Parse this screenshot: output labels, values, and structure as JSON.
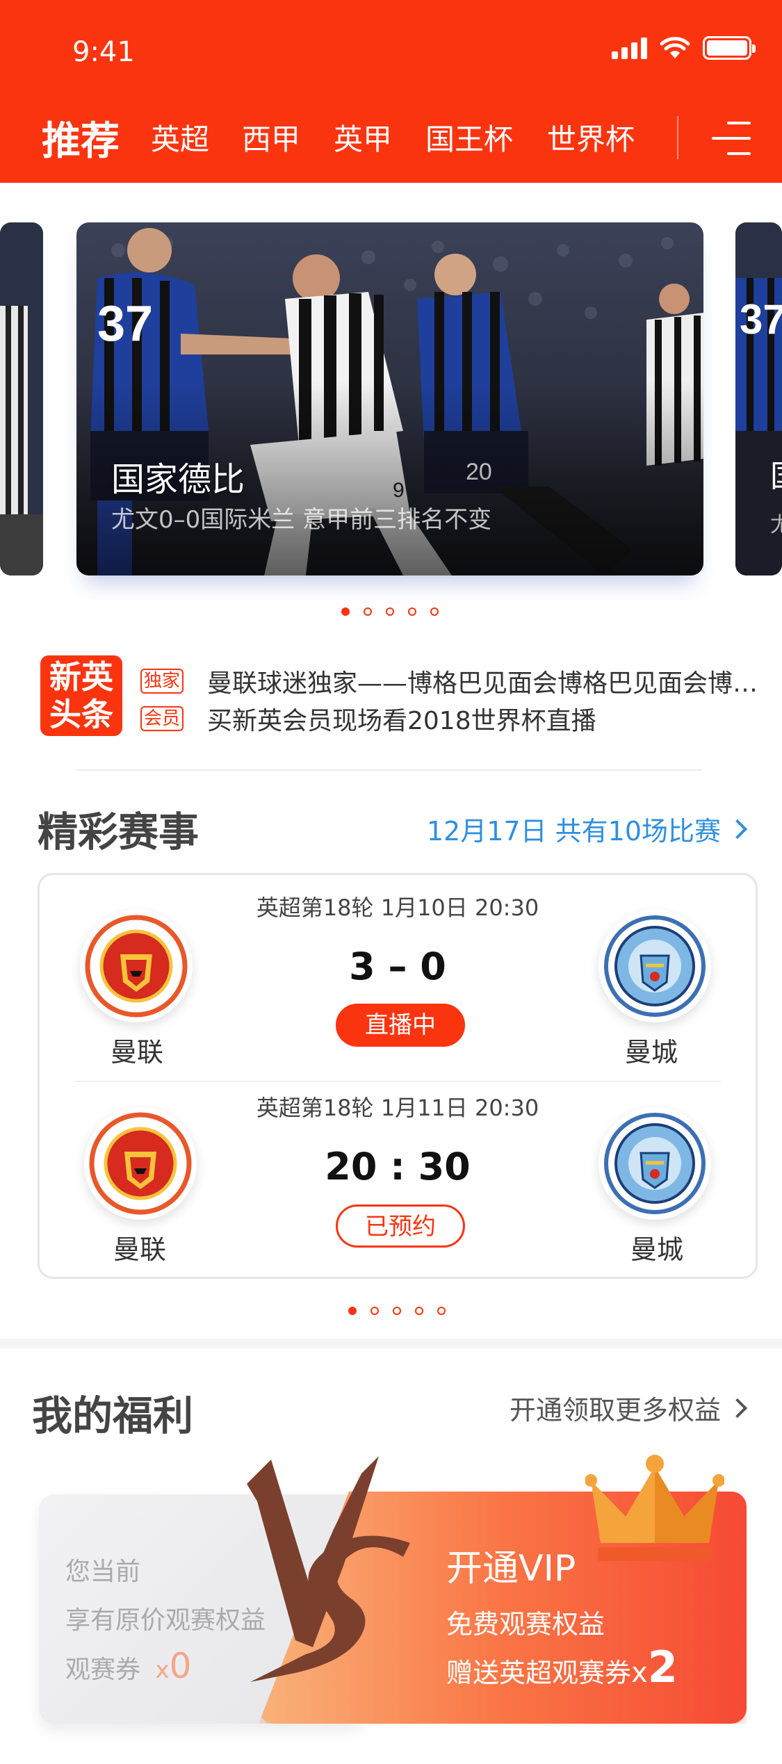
{
  "status": {
    "time": "9:41"
  },
  "tabs": [
    {
      "label": "推荐",
      "active": true
    },
    {
      "label": "英超"
    },
    {
      "label": "西甲"
    },
    {
      "label": "英甲"
    },
    {
      "label": "国王杯"
    },
    {
      "label": "世界杯"
    }
  ],
  "banner": {
    "title": "国家德比",
    "subtitle": "尤文0–0国际米兰 意甲前三排名不变",
    "side_title": "国",
    "side_sub": "尤",
    "dots": 5,
    "active_dot": 0
  },
  "news": {
    "logo": [
      "新英",
      "头条"
    ],
    "items": [
      {
        "tag": "独家",
        "text": "曼联球迷独家——博格巴见面会博格巴见面会博格巴见面会博格巴见面会"
      },
      {
        "tag": "会员",
        "text": "买新英会员现场看2018世界杯直播"
      }
    ]
  },
  "matches_section": {
    "title": "精彩赛事",
    "link": "12月17日 共有10场比赛"
  },
  "matches": [
    {
      "info": "英超第18轮  1月10日 20:30",
      "home": "曼联",
      "away": "曼城",
      "score": "3 – 0",
      "status": "直播中"
    },
    {
      "info": "英超第18轮  1月11日 20:30",
      "home": "曼联",
      "away": "曼城",
      "score": "20 : 30",
      "status": "已预约"
    }
  ],
  "match_dots": {
    "count": 5,
    "active": 0
  },
  "benefits": {
    "title": "我的福利",
    "link": "开通领取更多权益",
    "current": {
      "line1": "您当前",
      "line2": "享有原价观赛权益",
      "line3": "观赛券",
      "multiplier": "x",
      "count": "0"
    },
    "vip": {
      "title": "开通VIP",
      "line1": "免费观赛权益",
      "line2": "赠送英超观赛券",
      "multiplier": "x",
      "count": "2"
    },
    "vs": "VS"
  },
  "colors": {
    "accent": "#fb3410",
    "link_blue": "#2f8fe0",
    "man_utd": "#e8582a",
    "man_city": "#3d6fb3"
  }
}
